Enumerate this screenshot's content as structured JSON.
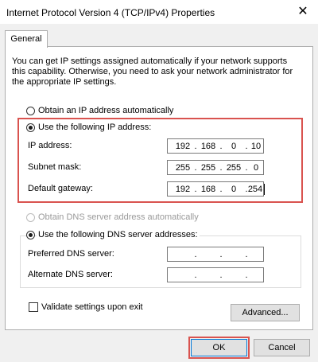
{
  "window": {
    "title": "Internet Protocol Version 4 (TCP/IPv4) Properties",
    "close_glyph": "✕"
  },
  "tabs": [
    {
      "label": "General",
      "selected": true
    }
  ],
  "intro_text": "You can get IP settings assigned automatically if your network supports this capability. Otherwise, you need to ask your network administrator for the appropriate IP settings.",
  "ip_mode": {
    "auto_label": "Obtain an IP address automatically",
    "manual_label": "Use the following IP address:",
    "selected": "manual"
  },
  "ip_fields": {
    "ip_address": {
      "label": "IP address:",
      "octets": [
        "192",
        "168",
        "0",
        "10"
      ]
    },
    "subnet_mask": {
      "label": "Subnet mask:",
      "octets": [
        "255",
        "255",
        "255",
        "0"
      ]
    },
    "default_gateway": {
      "label": "Default gateway:",
      "octets": [
        "192",
        "168",
        "0",
        "254"
      ]
    }
  },
  "dns_mode": {
    "auto_label": "Obtain DNS server address automatically",
    "manual_label": "Use the following DNS server addresses:",
    "selected": "manual",
    "auto_disabled": true
  },
  "dns_fields": {
    "preferred": {
      "label": "Preferred DNS server:",
      "octets": [
        "",
        "",
        "",
        ""
      ]
    },
    "alternate": {
      "label": "Alternate DNS server:",
      "octets": [
        "",
        "",
        "",
        ""
      ]
    }
  },
  "validate": {
    "label": "Validate settings upon exit",
    "checked": false
  },
  "buttons": {
    "advanced": "Advanced...",
    "ok": "OK",
    "cancel": "Cancel"
  },
  "colors": {
    "highlight": "#d9534f",
    "focus_border": "#0078d7",
    "dialog_bg": "#f0f0f0"
  },
  "icons": {
    "close": "close-icon",
    "radio": "radio-button",
    "checkbox": "checkbox"
  }
}
